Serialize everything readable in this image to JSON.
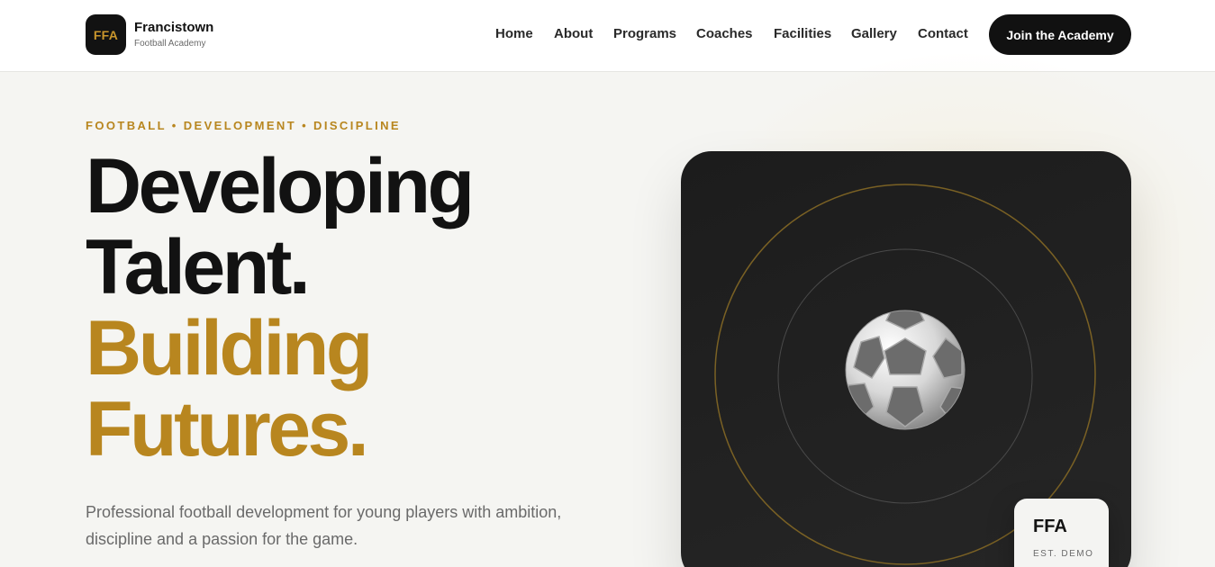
{
  "brand": {
    "logo_text": "FFA",
    "name": "Francistown",
    "subtitle": "Football Academy"
  },
  "nav": {
    "items": [
      {
        "label": "Home"
      },
      {
        "label": "About"
      },
      {
        "label": "Programs"
      },
      {
        "label": "Coaches"
      },
      {
        "label": "Facilities"
      },
      {
        "label": "Gallery"
      },
      {
        "label": "Contact"
      }
    ],
    "cta_label": "Join the Academy"
  },
  "hero": {
    "eyebrow": "FOOTBALL • DEVELOPMENT • DISCIPLINE",
    "headline": {
      "line1": "Developing",
      "line2": "Talent.",
      "line3": "Building",
      "line4": "Futures."
    },
    "description_line1": "Professional football development for young players with ambition,",
    "description_line2": "discipline and a passion for the game."
  },
  "card": {
    "ball_icon": "soccer-ball",
    "badge_title": "FFA",
    "badge_subtitle": "EST. DEMO"
  },
  "colors": {
    "accent_gold": "#b8861f",
    "dark": "#121212",
    "background": "#f5f5f2",
    "card_dark": "#1f1f1f"
  }
}
